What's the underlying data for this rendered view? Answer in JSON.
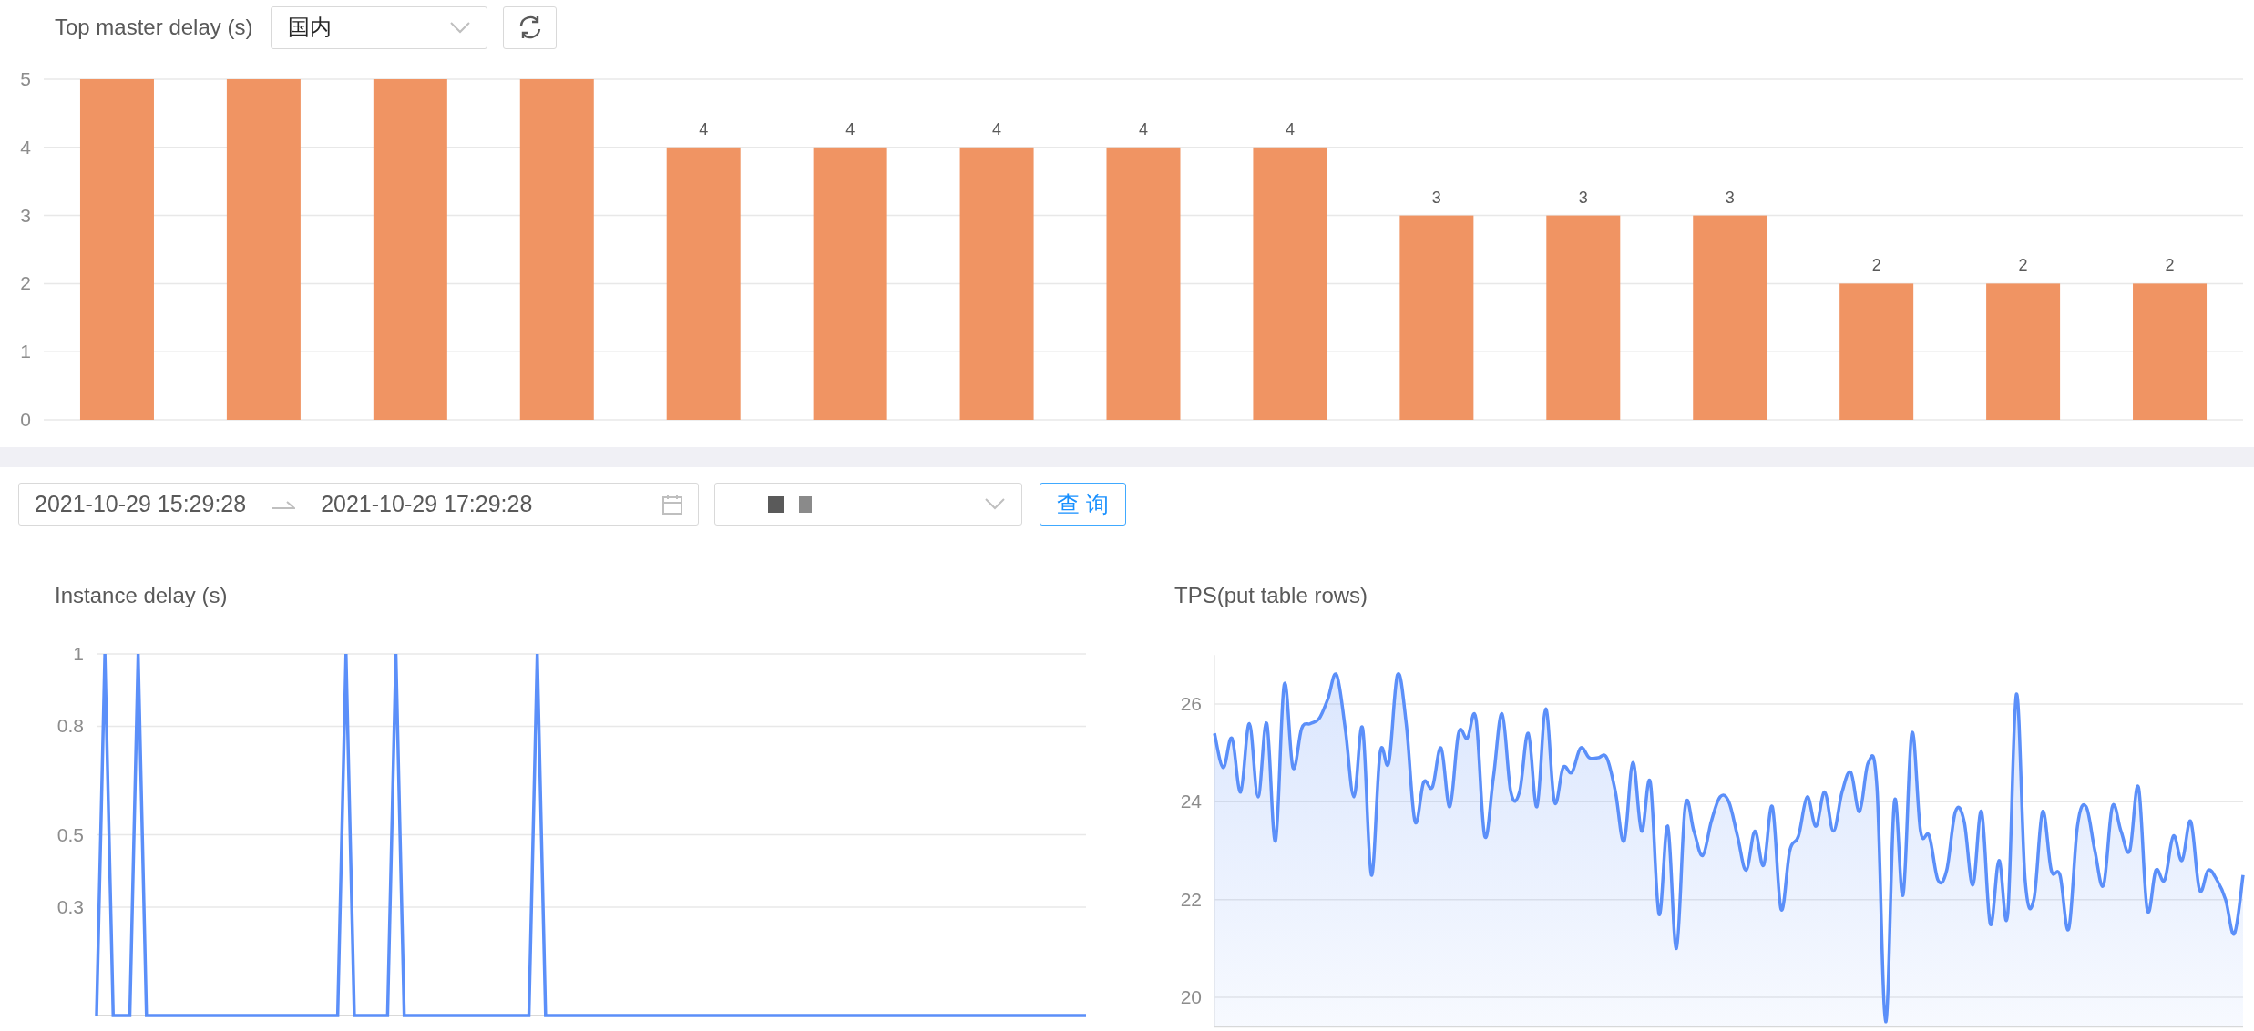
{
  "top_panel": {
    "title": "Top master delay (s)",
    "region_select": {
      "value": "国内"
    },
    "chart_data": {
      "type": "bar",
      "values": [
        5,
        5,
        5,
        5,
        4,
        4,
        4,
        4,
        4,
        3,
        3,
        3,
        2,
        2,
        2
      ],
      "ylim": [
        0,
        5
      ],
      "yticks": [
        0,
        1,
        2,
        3,
        4,
        5
      ],
      "grid": true,
      "value_labels": [
        null,
        null,
        null,
        null,
        "4",
        "4",
        "4",
        "4",
        "4",
        "3",
        "3",
        "3",
        "2",
        "2",
        "2"
      ]
    }
  },
  "query_bar": {
    "time_range": {
      "start": "2021-10-29 15:29:28",
      "end": "2021-10-29 17:29:28"
    },
    "query_button": "查 询"
  },
  "instance_delay": {
    "title": "Instance delay (s)",
    "chart_data": {
      "type": "line",
      "values": [
        0,
        1,
        0,
        0,
        0,
        1,
        0,
        0,
        0,
        0,
        0,
        0,
        0,
        0,
        0,
        0,
        0,
        0,
        0,
        0,
        0,
        0,
        0,
        0,
        0,
        0,
        0,
        0,
        0,
        0,
        1,
        0,
        0,
        0,
        0,
        0,
        1,
        0,
        0,
        0,
        0,
        0,
        0,
        0,
        0,
        0,
        0,
        0,
        0,
        0,
        0,
        0,
        0,
        1,
        0,
        0,
        0,
        0,
        0,
        0,
        0,
        0,
        0,
        0,
        0,
        0,
        0,
        0,
        0,
        0,
        0,
        0,
        0,
        0,
        0,
        0,
        0,
        0,
        0,
        0,
        0,
        0,
        0,
        0,
        0,
        0,
        0,
        0,
        0,
        0,
        0,
        0,
        0,
        0,
        0,
        0,
        0,
        0,
        0,
        0,
        0,
        0,
        0,
        0,
        0,
        0,
        0,
        0,
        0,
        0,
        0,
        0,
        0,
        0,
        0,
        0,
        0,
        0,
        0,
        0
      ],
      "ylim": [
        0,
        1
      ],
      "yticks": [
        0.3,
        0.5,
        0.8,
        1
      ],
      "grid": true
    }
  },
  "tps": {
    "title": "TPS(put table rows)",
    "chart_data": {
      "type": "area",
      "values": [
        25.4,
        24.7,
        25.3,
        24.2,
        25.6,
        24.1,
        25.6,
        23.2,
        26.4,
        24.7,
        25.5,
        25.6,
        25.7,
        26.1,
        26.6,
        25.5,
        24.1,
        25.5,
        22.5,
        25.0,
        24.8,
        26.6,
        25.6,
        23.6,
        24.4,
        24.3,
        25.1,
        23.9,
        25.4,
        25.3,
        25.7,
        23.3,
        24.5,
        25.8,
        24.2,
        24.2,
        25.4,
        23.9,
        25.9,
        24.0,
        24.7,
        24.6,
        25.1,
        24.9,
        24.9,
        24.9,
        24.2,
        23.2,
        24.8,
        23.4,
        24.4,
        21.7,
        23.5,
        21.0,
        23.9,
        23.4,
        22.9,
        23.6,
        24.1,
        24.0,
        23.3,
        22.6,
        23.4,
        22.7,
        23.9,
        21.8,
        23.0,
        23.3,
        24.1,
        23.5,
        24.2,
        23.4,
        24.2,
        24.6,
        23.8,
        24.8,
        24.3,
        19.5,
        24.0,
        22.1,
        25.4,
        23.4,
        23.3,
        22.4,
        22.6,
        23.8,
        23.6,
        22.3,
        23.8,
        21.5,
        22.8,
        21.7,
        26.2,
        22.4,
        22.0,
        23.8,
        22.6,
        22.5,
        21.4,
        23.5,
        23.9,
        23.0,
        22.3,
        23.9,
        23.4,
        23.0,
        24.3,
        21.8,
        22.6,
        22.4,
        23.3,
        22.8,
        23.6,
        22.2,
        22.6,
        22.4,
        22.0,
        21.3,
        22.5
      ],
      "ylim": [
        19.4,
        27
      ],
      "yticks": [
        20,
        22,
        24,
        26
      ],
      "grid": true
    }
  }
}
